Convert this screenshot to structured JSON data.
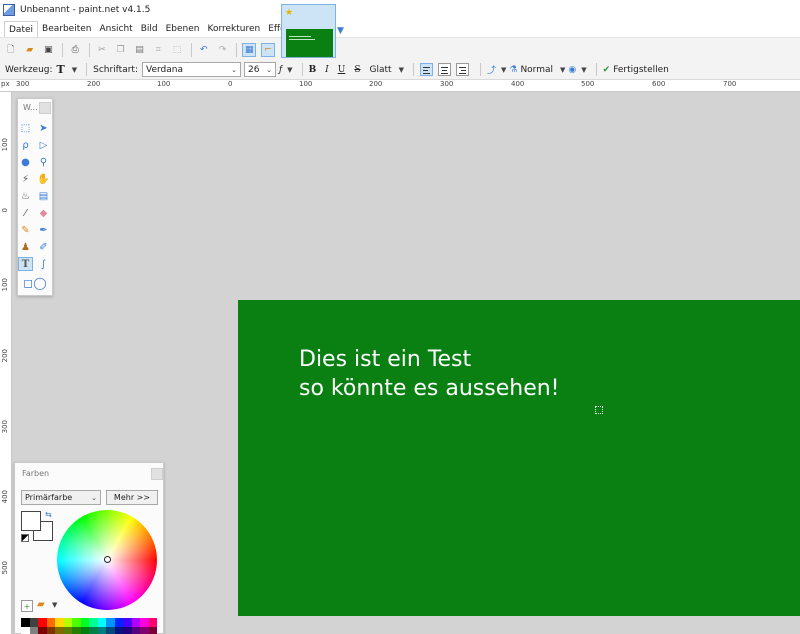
{
  "window": {
    "title": "Unbenannt - paint.net v4.1.5"
  },
  "menu": {
    "items": [
      "Datei",
      "Bearbeiten",
      "Ansicht",
      "Bild",
      "Ebenen",
      "Korrekturen",
      "Effekte"
    ]
  },
  "toolbar": {
    "tool_label": "Werkzeug:",
    "font_label": "Schriftart:",
    "font_value": "Verdana",
    "size_value": "26",
    "bold": "B",
    "italic": "I",
    "underline": "U",
    "strike": "S",
    "antialias": "Glatt",
    "blend_mode": "Normal",
    "finish": "Fertigstellen"
  },
  "ruler": {
    "unit": "px",
    "h_labels": [
      "300",
      "200",
      "100",
      "0",
      "100",
      "200",
      "300",
      "400",
      "500",
      "600",
      "700"
    ],
    "v_labels": [
      "100",
      "0",
      "100",
      "200",
      "300",
      "400",
      "500"
    ]
  },
  "canvas": {
    "background": "#0a8013",
    "lines": [
      "Dies ist ein Test",
      "so könnte es aussehen!"
    ]
  },
  "tools_window": {
    "title": "W..."
  },
  "colors_window": {
    "title": "Farben",
    "mode": "Primärfarbe",
    "more": "Mehr >>",
    "palette": [
      "#000000",
      "#404040",
      "#ff0000",
      "#ff6a00",
      "#ffd800",
      "#b6ff00",
      "#4cff00",
      "#00ff21",
      "#00ff90",
      "#00ffff",
      "#0094ff",
      "#0026ff",
      "#4800ff",
      "#b200ff",
      "#ff00dc",
      "#ff006e",
      "#ffffff",
      "#808080",
      "#7f0000",
      "#7f3300",
      "#7f6a00",
      "#5b7f00",
      "#267f00",
      "#007f0e",
      "#007f46",
      "#007f7f",
      "#004a7f",
      "#00137f",
      "#21007f",
      "#57007f",
      "#7f006e",
      "#7f0037"
    ]
  }
}
